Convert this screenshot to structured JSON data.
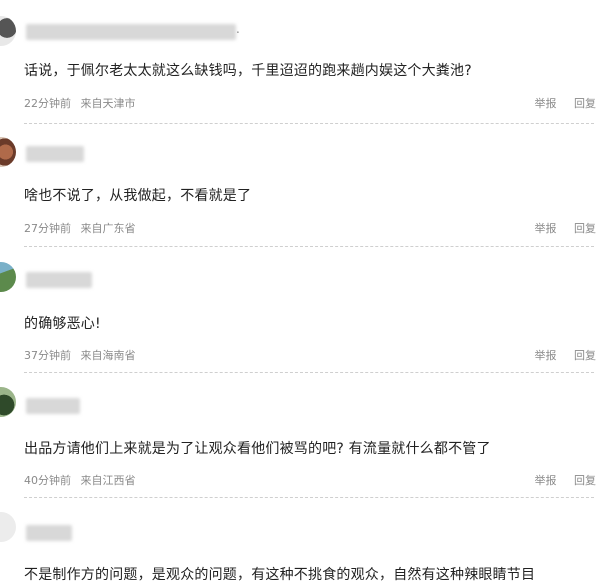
{
  "comments": [
    {
      "text": "话说，于佩尔老太太就这么缺钱吗，千里迢迢的跑来趟内娱这个大粪池?",
      "time": "22分钟前",
      "location": "来自天津市",
      "name_trailing": "."
    },
    {
      "text": "啥也不说了，从我做起，不看就是了",
      "time": "27分钟前",
      "location": "来自广东省",
      "name_trailing": ""
    },
    {
      "text": "的确够恶心!",
      "time": "37分钟前",
      "location": "来自海南省",
      "name_trailing": ""
    },
    {
      "text": "出品方请他们上来就是为了让观众看他们被骂的吧? 有流量就什么都不管了",
      "time": "40分钟前",
      "location": "来自江西省",
      "name_trailing": ""
    },
    {
      "text": "不是制作方的问题，是观众的问题，有这种不挑食的观众，自然有这种辣眼睛节目",
      "time": "",
      "location": "",
      "name_trailing": ""
    }
  ],
  "actions": {
    "report": "举报",
    "reply": "回复"
  },
  "colors": {
    "meta": "#8a8a8a",
    "divider": "#cfcfcf",
    "text": "#222222"
  }
}
